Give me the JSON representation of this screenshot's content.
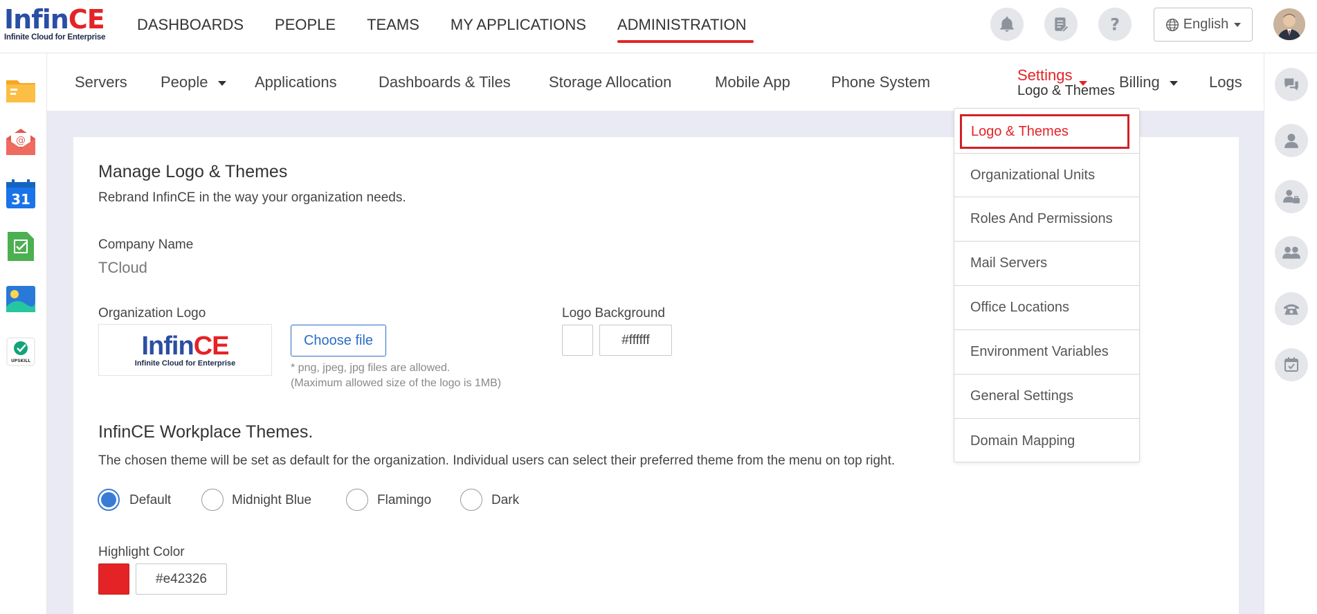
{
  "brand": {
    "word_part1": "Infin",
    "word_part2": "CE",
    "tagline": "Infinite Cloud for Enterprise"
  },
  "mainnav": [
    "DASHBOARDS",
    "PEOPLE",
    "TEAMS",
    "MY APPLICATIONS",
    "ADMINISTRATION"
  ],
  "header": {
    "language": "English",
    "icons": [
      "bell-icon",
      "notes-icon",
      "help-icon",
      "globe-icon"
    ]
  },
  "apps": [
    "folder-app-icon",
    "mail-app-icon",
    "calendar-app-icon",
    "tasks-app-icon",
    "photos-app-icon",
    "upskill-app-icon"
  ],
  "calendar_day": "31",
  "upskill_label": "UPSKILL",
  "subnav": {
    "servers": "Servers",
    "people": "People",
    "applications": "Applications",
    "dashboards": "Dashboards & Tiles",
    "storage": "Storage Allocation",
    "mobile": "Mobile App",
    "phone": "Phone System",
    "settings": "Settings",
    "settings_sub": "Logo & Themes",
    "billing": "Billing",
    "logs": "Logs"
  },
  "dropdown": [
    "Logo & Themes",
    "Organizational Units",
    "Roles And Permissions",
    "Mail Servers",
    "Office Locations",
    "Environment Variables",
    "General Settings",
    "Domain Mapping"
  ],
  "content": {
    "title": "Manage Logo & Themes",
    "subtitle": "Rebrand InfinCE in the way your organization needs.",
    "company_label": "Company Name",
    "company_value": "TCloud",
    "org_logo_label": "Organization Logo",
    "choose_file": "Choose file",
    "file_note1": "* png, jpeg, jpg files are allowed.",
    "file_note2": "(Maximum allowed size of the logo is 1MB)",
    "logo_bg_label": "Logo Background",
    "logo_bg_value": "#ffffff",
    "themes_title": "InfinCE Workplace Themes.",
    "themes_desc": "The chosen theme will be set as default for the organization. Individual users can select their preferred theme from the menu on top right.",
    "themes": [
      "Default",
      "Midnight Blue",
      "Flamingo",
      "Dark"
    ],
    "selected_theme": "Default",
    "highlight_label": "Highlight Color",
    "highlight_value": "#e42326"
  },
  "colors": {
    "accent": "#e42326",
    "brand_blue": "#2a4ea4",
    "radio_blue": "#3a7bd5"
  }
}
